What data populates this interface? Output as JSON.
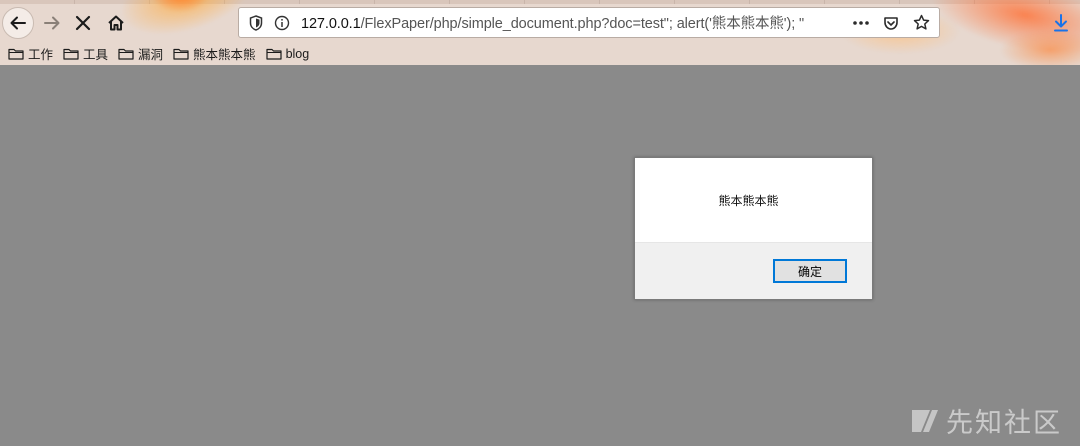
{
  "browser": {
    "url_host": "127.0.0.1",
    "url_rest": "/FlexPaper/php/simple_document.php?doc=test\"; alert('熊本熊本熊'); \"",
    "icons": {
      "back": "back-arrow-icon",
      "forward": "forward-arrow-icon",
      "stop": "stop-icon",
      "home": "home-icon",
      "shield": "tracking-shield-icon",
      "info": "info-icon",
      "more": "more-actions-icon",
      "pocket": "pocket-icon",
      "bookmark_star": "star-icon",
      "download": "download-icon"
    },
    "bookmarks": [
      {
        "label": "工作",
        "icon": "folder-icon"
      },
      {
        "label": "工具",
        "icon": "folder-icon"
      },
      {
        "label": "漏洞",
        "icon": "folder-icon"
      },
      {
        "label": "熊本熊本熊",
        "icon": "folder-icon"
      },
      {
        "label": "blog",
        "icon": "folder-icon"
      }
    ]
  },
  "dialog": {
    "message": "熊本熊本熊",
    "ok_label": "确定"
  },
  "watermark": {
    "text": "先知社区"
  },
  "colors": {
    "page_background": "#8a8a8a",
    "chrome_background": "#e7d8cf",
    "accent": "#0078d7",
    "download_blue": "#1a73e8"
  }
}
